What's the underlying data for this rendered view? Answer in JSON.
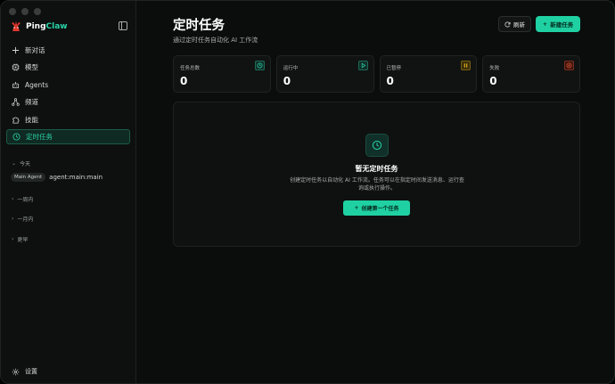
{
  "app": {
    "brand_prefix": "Ping",
    "brand_accent": "Claw",
    "accent_color": "#1fd1a2"
  },
  "sidebar": {
    "nav": [
      {
        "label": "新对话",
        "icon": "plus-icon"
      },
      {
        "label": "模型",
        "icon": "cpu-icon"
      },
      {
        "label": "Agents",
        "icon": "bot-icon"
      },
      {
        "label": "频道",
        "icon": "network-icon"
      },
      {
        "label": "技能",
        "icon": "puzzle-icon"
      },
      {
        "label": "定时任务",
        "icon": "clock-icon",
        "active": true
      }
    ],
    "groups": {
      "today": "今天",
      "week": "一周内",
      "month": "一月内",
      "earlier": "更早"
    },
    "session": {
      "badge": "Main Agent",
      "name": "agent:main:main"
    },
    "settings_label": "设置"
  },
  "main": {
    "title": "定时任务",
    "subtitle": "通过定时任务自动化 AI 工作流",
    "refresh_label": "刷新",
    "new_label": "新建任务",
    "stats": [
      {
        "label": "任务总数",
        "value": "0",
        "icon": "clock-icon",
        "color": "#2ad4a8"
      },
      {
        "label": "运行中",
        "value": "0",
        "icon": "play-icon",
        "color": "#2ad4a8"
      },
      {
        "label": "已暂停",
        "value": "0",
        "icon": "pause-icon",
        "color": "#e0b020"
      },
      {
        "label": "失败",
        "value": "0",
        "icon": "x-circle-icon",
        "color": "#e8532f"
      }
    ],
    "empty": {
      "title": "暂无定时任务",
      "description": "创建定时任务以自动化 AI 工作流。任务可以在指定时间发送消息、运行查询或执行操作。",
      "button_label": "创建第一个任务"
    }
  }
}
